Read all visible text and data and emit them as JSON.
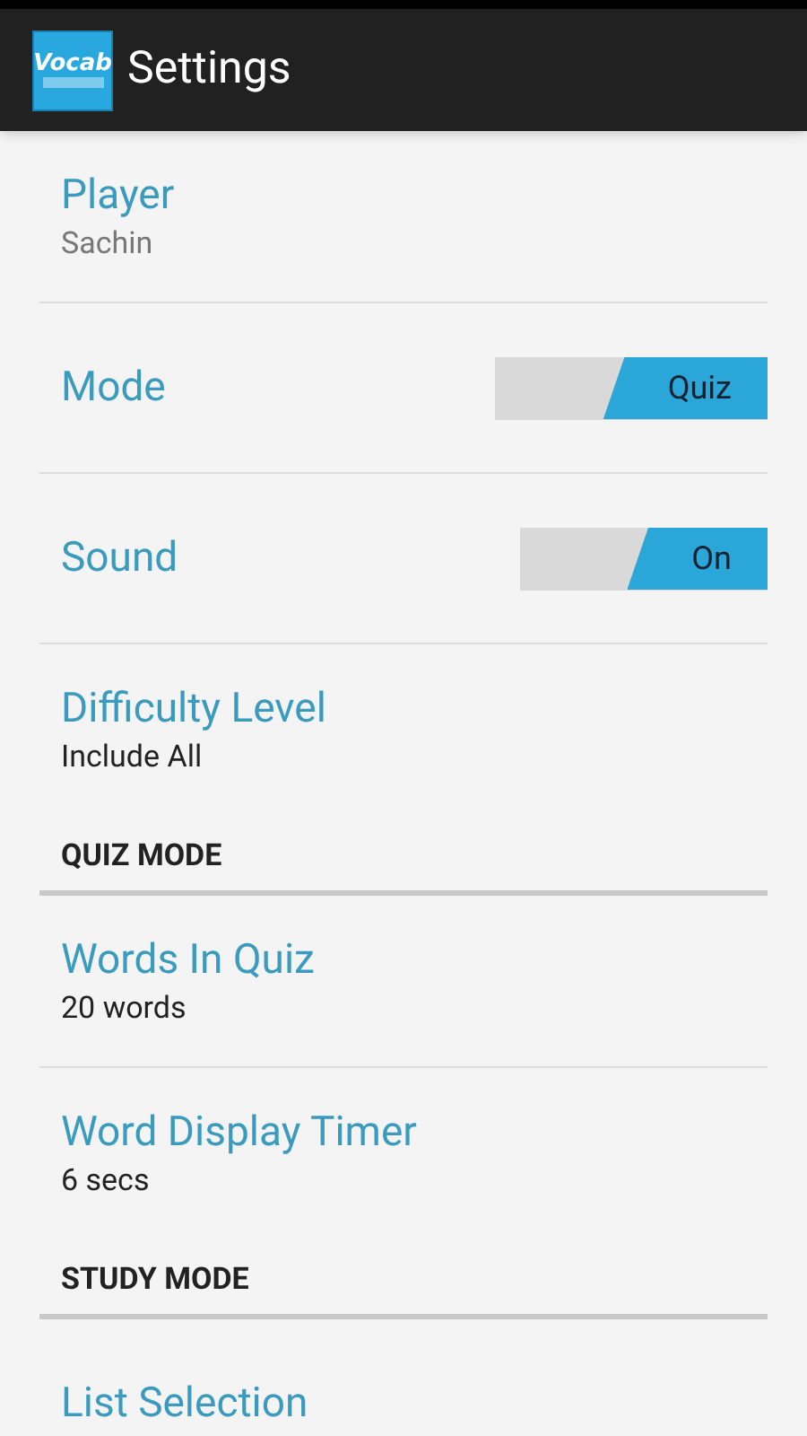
{
  "action_bar": {
    "logo_text": "Vocab",
    "title": "Settings"
  },
  "items": [
    {
      "kind": "summary",
      "title": "Player",
      "summary": "Sachin",
      "muted": true
    },
    {
      "kind": "toggle",
      "title": "Mode",
      "toggle_text": "Quiz",
      "on": true
    },
    {
      "kind": "toggle",
      "title": "Sound",
      "toggle_text": "On",
      "on": true
    },
    {
      "kind": "summary",
      "title": "Difficulty Level",
      "summary": "Include All",
      "muted": false
    },
    {
      "kind": "header",
      "title": "QUIZ MODE"
    },
    {
      "kind": "summary",
      "title": "Words In Quiz",
      "summary": "20 words",
      "muted": false
    },
    {
      "kind": "summary",
      "title": "Word Display Timer",
      "summary": "6 secs",
      "muted": false
    },
    {
      "kind": "header",
      "title": "STUDY MODE"
    },
    {
      "kind": "summary",
      "title": "List Selection"
    }
  ]
}
